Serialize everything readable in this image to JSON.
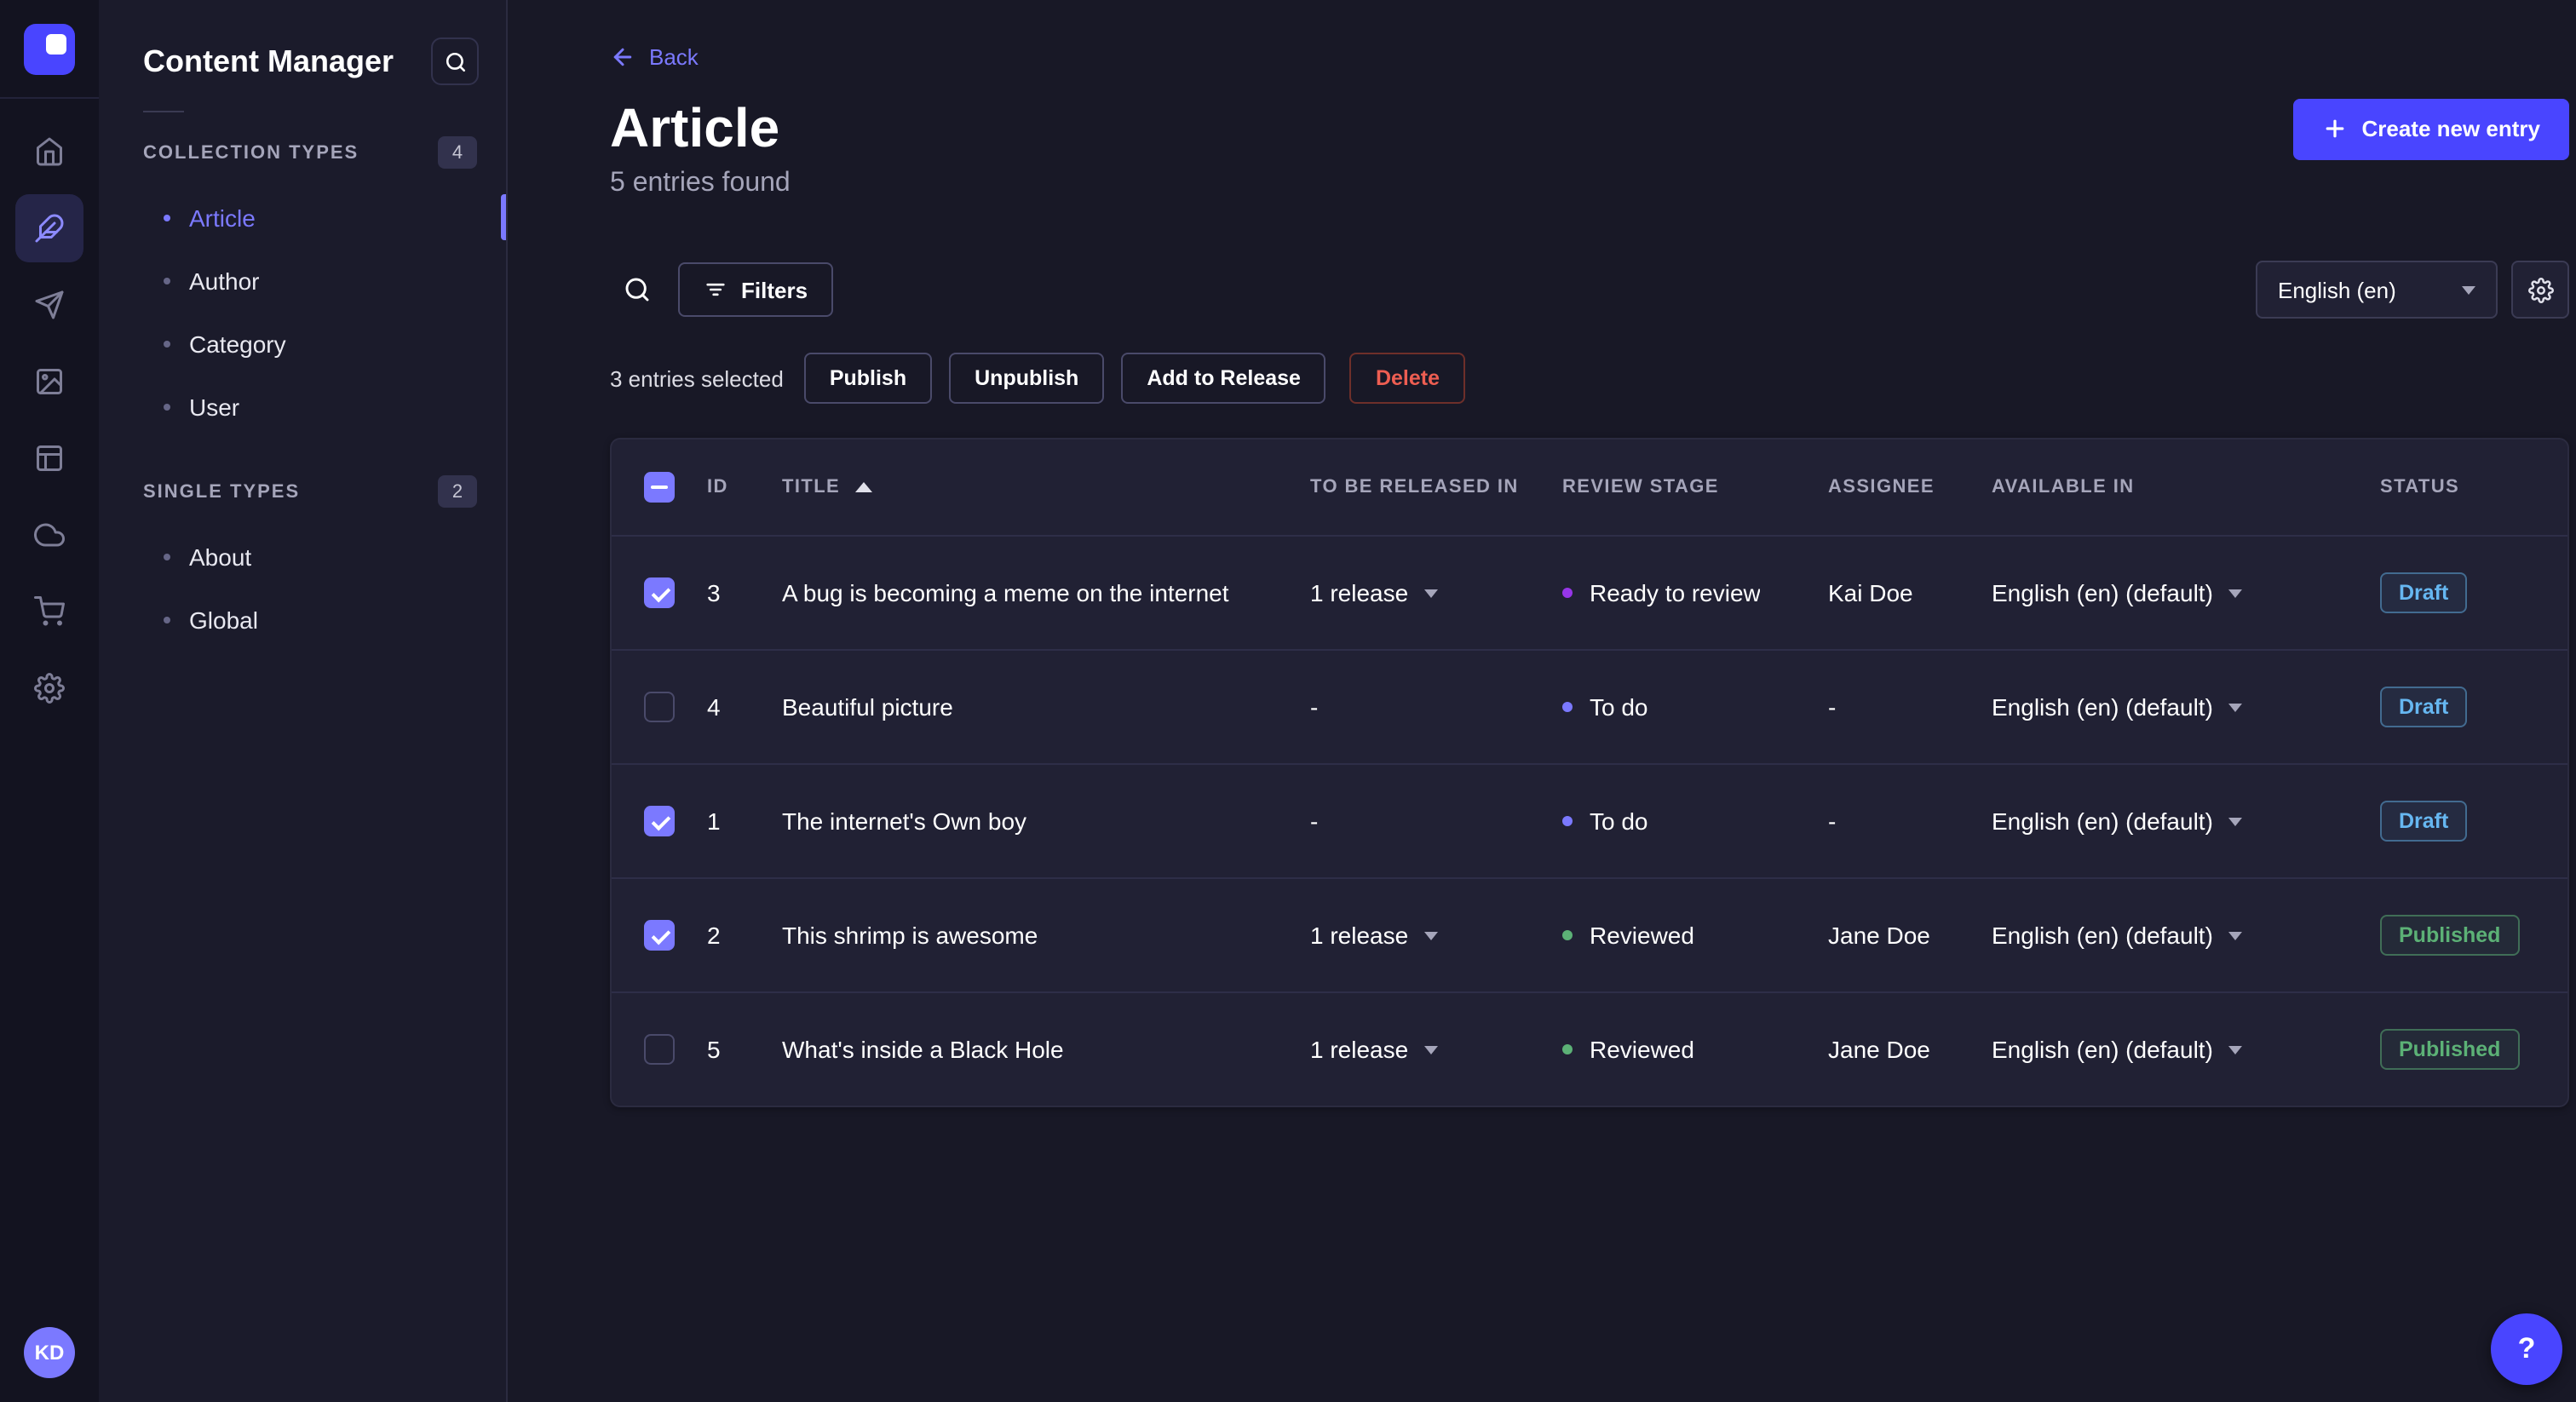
{
  "colors": {
    "accent": "#4945ff",
    "link": "#7b79ff",
    "draft": "#66b7f1",
    "published": "#5cb176",
    "danger": "#ee5e52",
    "stage_todo": "#7b79ff",
    "stage_ready_to_review": "#9736e8",
    "stage_reviewed": "#5cb176"
  },
  "rail": {
    "icons": [
      "strapi-logo",
      "home",
      "content-manager",
      "releases",
      "media-library",
      "content-type-builder",
      "cloud",
      "marketplace",
      "settings"
    ],
    "active_icon": "content-manager",
    "avatar_initials": "KD"
  },
  "subnav": {
    "title": "Content Manager",
    "sections": [
      {
        "label": "COLLECTION TYPES",
        "count": "4",
        "items": [
          {
            "label": "Article",
            "active": true
          },
          {
            "label": "Author",
            "active": false
          },
          {
            "label": "Category",
            "active": false
          },
          {
            "label": "User",
            "active": false
          }
        ]
      },
      {
        "label": "SINGLE TYPES",
        "count": "2",
        "items": [
          {
            "label": "About",
            "active": false
          },
          {
            "label": "Global",
            "active": false
          }
        ]
      }
    ]
  },
  "header": {
    "back_label": "Back",
    "title": "Article",
    "subtitle": "5 entries found",
    "create_button": "Create new entry"
  },
  "toolbar": {
    "filters_label": "Filters",
    "locale": "English (en)"
  },
  "selection": {
    "count_text": "3 entries selected",
    "buttons": {
      "publish": "Publish",
      "unpublish": "Unpublish",
      "add_to_release": "Add to Release",
      "delete": "Delete"
    }
  },
  "table": {
    "header_checkbox": "indeterminate",
    "sort": {
      "column": "TITLE",
      "direction": "asc"
    },
    "headers": [
      "ID",
      "TITLE",
      "TO BE RELEASED IN",
      "REVIEW STAGE",
      "ASSIGNEE",
      "AVAILABLE IN",
      "STATUS"
    ],
    "rows": [
      {
        "checked": true,
        "id": "3",
        "title": "A bug is becoming a meme on the internet",
        "release": "1 release",
        "stage": "Ready to review",
        "stage_color": "#9736e8",
        "assignee": "Kai Doe",
        "available_in": "English (en) (default)",
        "status": "Draft"
      },
      {
        "checked": false,
        "id": "4",
        "title": "Beautiful picture",
        "release": "-",
        "stage": "To do",
        "stage_color": "#7b79ff",
        "assignee": "-",
        "available_in": "English (en) (default)",
        "status": "Draft"
      },
      {
        "checked": true,
        "id": "1",
        "title": "The internet's Own boy",
        "release": "-",
        "stage": "To do",
        "stage_color": "#7b79ff",
        "assignee": "-",
        "available_in": "English (en) (default)",
        "status": "Draft"
      },
      {
        "checked": true,
        "id": "2",
        "title": "This shrimp is awesome",
        "release": "1 release",
        "stage": "Reviewed",
        "stage_color": "#5cb176",
        "assignee": "Jane Doe",
        "available_in": "English (en) (default)",
        "status": "Published"
      },
      {
        "checked": false,
        "id": "5",
        "title": "What's inside a Black Hole",
        "release": "1 release",
        "stage": "Reviewed",
        "stage_color": "#5cb176",
        "assignee": "Jane Doe",
        "available_in": "English (en) (default)",
        "status": "Published"
      }
    ]
  },
  "help": {
    "icon": "question-mark"
  }
}
